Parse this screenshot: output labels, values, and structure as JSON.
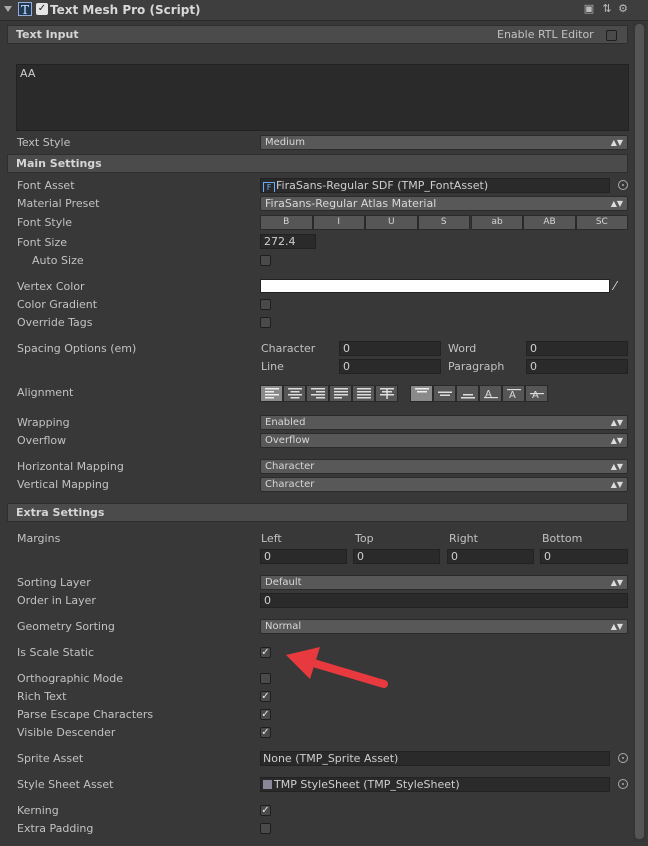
{
  "header": {
    "title": "Text Mesh Pro (Script)"
  },
  "text_input": {
    "section_title": "Text Input",
    "rtl_label": "Enable RTL Editor",
    "text": "AA",
    "text_style_label": "Text Style",
    "text_style_value": "Medium"
  },
  "main_settings": {
    "section_title": "Main Settings",
    "font_asset_label": "Font Asset",
    "font_asset_value": "FiraSans-Regular SDF (TMP_FontAsset)",
    "material_preset_label": "Material Preset",
    "material_preset_value": "FiraSans-Regular Atlas Material",
    "font_style_label": "Font Style",
    "font_style_buttons_a": [
      "B",
      "I",
      "U",
      "S"
    ],
    "font_style_buttons_b": [
      "ab",
      "AB",
      "SC"
    ],
    "font_size_label": "Font Size",
    "font_size_value": "272.4",
    "auto_size_label": "Auto Size",
    "vertex_color_label": "Vertex Color",
    "vertex_color": "#ffffff",
    "color_gradient_label": "Color Gradient",
    "override_tags_label": "Override Tags",
    "spacing_label": "Spacing Options (em)",
    "character_label": "Character",
    "character_value": "0",
    "word_label": "Word",
    "word_value": "0",
    "line_label": "Line",
    "line_value": "0",
    "paragraph_label": "Paragraph",
    "paragraph_value": "0",
    "alignment_label": "Alignment",
    "wrapping_label": "Wrapping",
    "wrapping_value": "Enabled",
    "overflow_label": "Overflow",
    "overflow_value": "Overflow",
    "h_mapping_label": "Horizontal Mapping",
    "h_mapping_value": "Character",
    "v_mapping_label": "Vertical Mapping",
    "v_mapping_value": "Character"
  },
  "extra_settings": {
    "section_title": "Extra Settings",
    "margins_label": "Margins",
    "left_label": "Left",
    "left_value": "0",
    "top_label": "Top",
    "top_value": "0",
    "right_label": "Right",
    "right_value": "0",
    "bottom_label": "Bottom",
    "bottom_value": "0",
    "sorting_layer_label": "Sorting Layer",
    "sorting_layer_value": "Default",
    "order_label": "Order in Layer",
    "order_value": "0",
    "geometry_label": "Geometry Sorting",
    "geometry_value": "Normal",
    "scale_static_label": "Is Scale Static",
    "ortho_label": "Orthographic Mode",
    "rich_text_label": "Rich Text",
    "parse_escape_label": "Parse Escape Characters",
    "visible_desc_label": "Visible Descender",
    "sprite_asset_label": "Sprite Asset",
    "sprite_asset_value": "None (TMP_Sprite Asset)",
    "style_sheet_label": "Style Sheet Asset",
    "style_sheet_value": "TMP StyleSheet (TMP_StyleSheet)",
    "kerning_label": "Kerning",
    "extra_padding_label": "Extra Padding"
  },
  "colors": {
    "annotation_arrow": "#e8393f"
  }
}
